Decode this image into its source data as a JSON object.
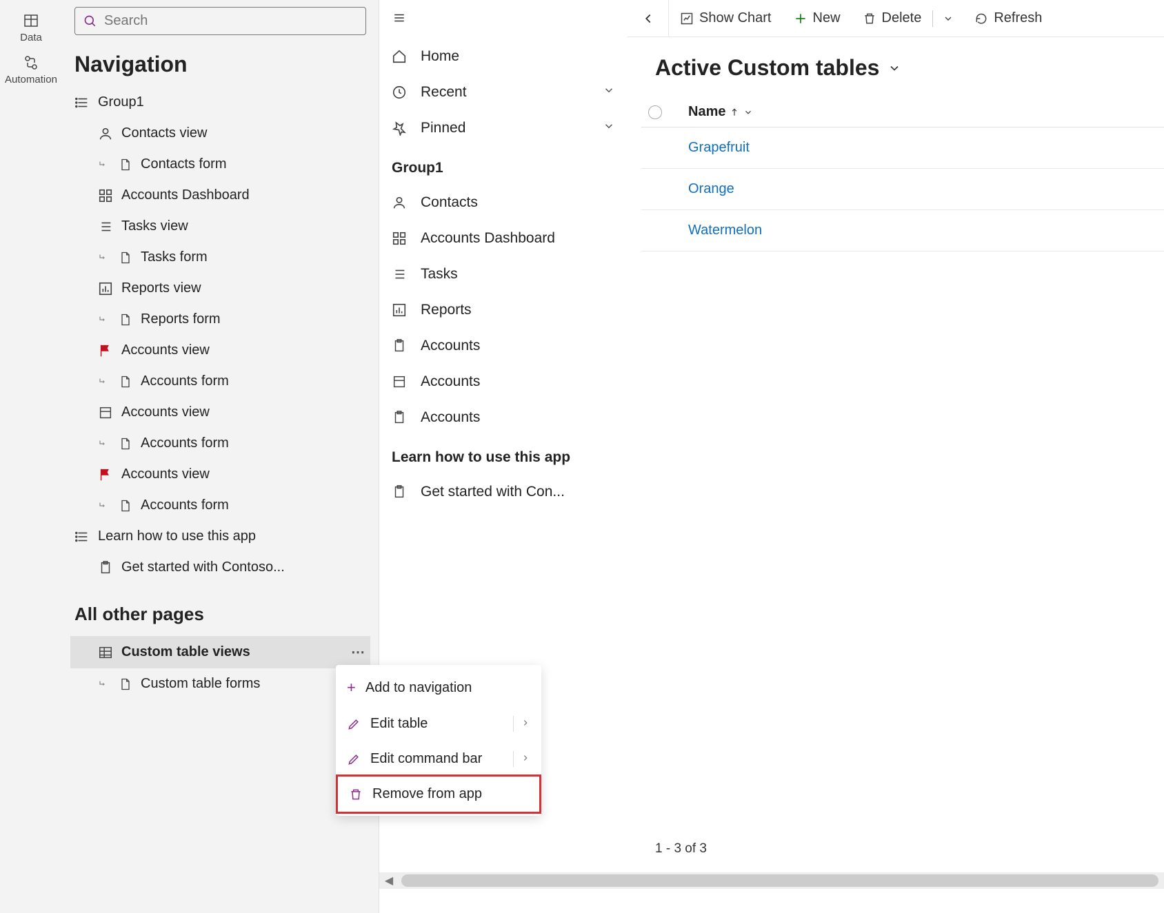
{
  "leftRail": {
    "data": "Data",
    "automation": "Automation"
  },
  "navPanel": {
    "searchPlaceholder": "Search",
    "title": "Navigation",
    "group1": "Group1",
    "items": [
      "Contacts view",
      "Contacts form",
      "Accounts Dashboard",
      "Tasks view",
      "Tasks form",
      "Reports view",
      "Reports form",
      "Accounts view",
      "Accounts form",
      "Accounts view",
      "Accounts form",
      "Accounts view",
      "Accounts form"
    ],
    "learnGroup": "Learn how to use this app",
    "learnItem": "Get started with Contoso...",
    "otherPagesTitle": "All other pages",
    "customTableViews": "Custom table views",
    "customTableForms": "Custom table forms"
  },
  "sitemap": {
    "home": "Home",
    "recent": "Recent",
    "pinned": "Pinned",
    "group1": "Group1",
    "items": [
      "Contacts",
      "Accounts Dashboard",
      "Tasks",
      "Reports",
      "Accounts",
      "Accounts",
      "Accounts"
    ],
    "learnGroup": "Learn how to use this app",
    "learnItem": "Get started with Con..."
  },
  "main": {
    "cmdShowChart": "Show Chart",
    "cmdNew": "New",
    "cmdDelete": "Delete",
    "cmdRefresh": "Refresh",
    "viewTitle": "Active Custom tables",
    "colName": "Name",
    "rows": [
      "Grapefruit",
      "Orange",
      "Watermelon"
    ],
    "footer": "1 - 3 of 3"
  },
  "contextMenu": {
    "addToNav": "Add to navigation",
    "editTable": "Edit table",
    "editCmdBar": "Edit command bar",
    "removeFromApp": "Remove from app"
  }
}
